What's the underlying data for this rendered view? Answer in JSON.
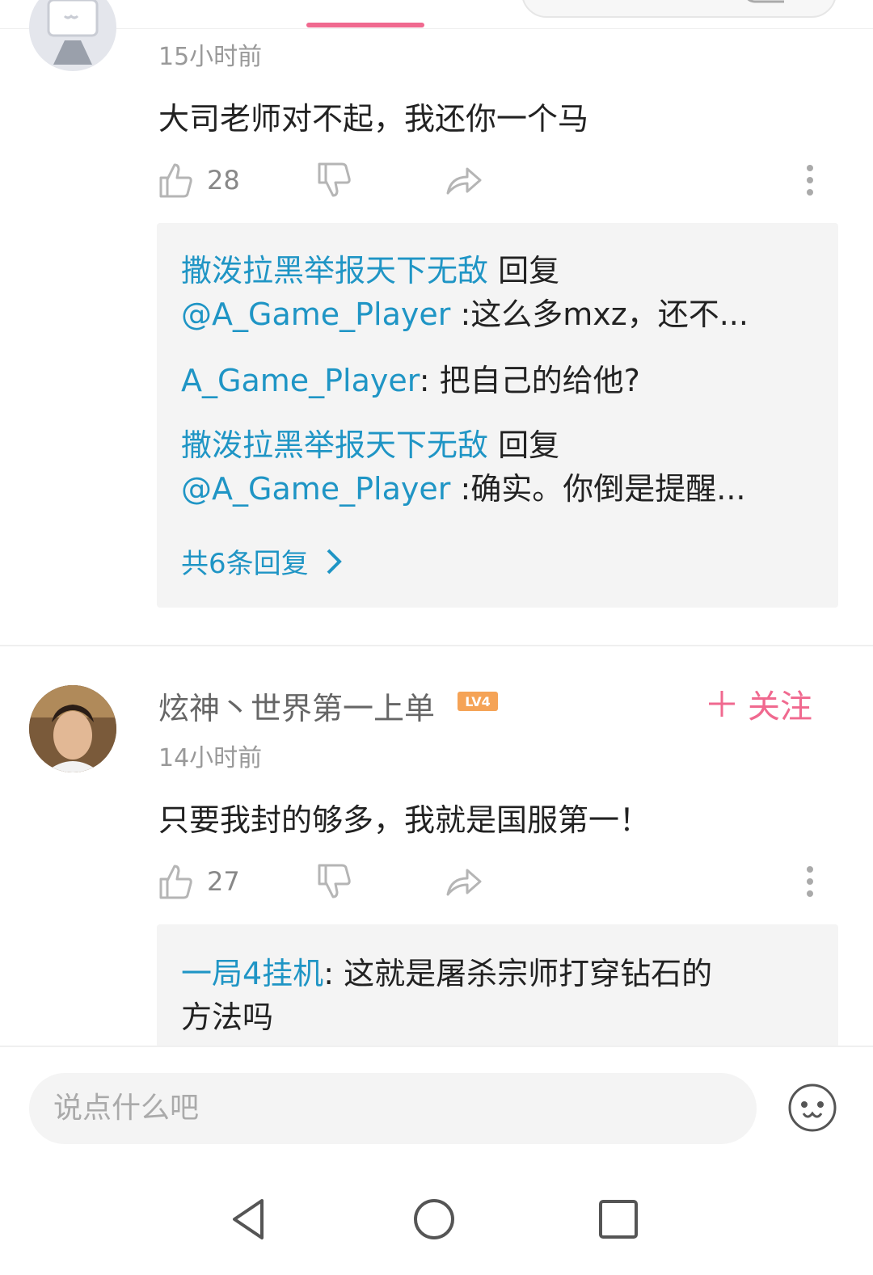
{
  "comment1": {
    "time": "15小时前",
    "text": "大司老师对不起，我还你一个马",
    "likes": "28",
    "replies": [
      {
        "user": "撒泼拉黑举报天下无敌",
        "verb": " 回复",
        "mention": "@A_Game_Player",
        "text": " :这么多mxz，还不..."
      },
      {
        "user": "A_Game_Player",
        "text": ": 把自己的给他?"
      },
      {
        "user": "撒泼拉黑举报天下无敌",
        "verb": " 回复",
        "mention": "@A_Game_Player",
        "text": " :确实。你倒是提醒..."
      }
    ],
    "more_replies": "共6条回复"
  },
  "comment2": {
    "username": "炫神丶世界第一上单",
    "level": "LV4",
    "follow": "关注",
    "time": "14小时前",
    "text": "只要我封的够多，我就是国服第一！",
    "likes": "27",
    "reply": {
      "user": "一局4挂机",
      "text": ": 这就是屠杀宗师打穿钻石的",
      "text2": "方法吗"
    }
  },
  "input": {
    "placeholder": "说点什么吧"
  },
  "colors": {
    "accent_pink": "#f0698f",
    "link_blue": "#1f95c5"
  }
}
